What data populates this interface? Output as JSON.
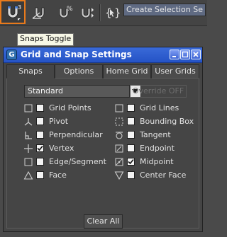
{
  "toolbar": {
    "tools": [
      {
        "icon": "snaps-toggle-icon",
        "sub": "3"
      },
      {
        "icon": "angle-snap-icon"
      },
      {
        "icon": "percent-snap-icon"
      },
      {
        "icon": "spinner-snap-icon"
      },
      {
        "icon": "edit-named-selection-icon",
        "text": "{}"
      }
    ],
    "selection_set_value": "Create Selection Se"
  },
  "tooltip": {
    "text": "Snaps Toggle"
  },
  "dialog": {
    "title": "Grid and Snap Settings",
    "title_icon_text": "G",
    "tabs": [
      "Snaps",
      "Options",
      "Home Grid",
      "User Grids"
    ],
    "active_tab": "Snaps",
    "dropdown_value": "Standard",
    "override_label": "Override OFF",
    "snaps_left": [
      {
        "label": "Grid Points",
        "icon": "grid-points-icon",
        "checked": false
      },
      {
        "label": "Pivot",
        "icon": "pivot-icon",
        "checked": false
      },
      {
        "label": "Perpendicular",
        "icon": "perpendicular-icon",
        "checked": false
      },
      {
        "label": "Vertex",
        "icon": "vertex-icon",
        "checked": true
      },
      {
        "label": "Edge/Segment",
        "icon": "edge-segment-icon",
        "checked": false
      },
      {
        "label": "Face",
        "icon": "face-icon",
        "checked": false
      }
    ],
    "snaps_right": [
      {
        "label": "Grid Lines",
        "icon": "grid-lines-icon",
        "checked": false
      },
      {
        "label": "Bounding Box",
        "icon": "bounding-box-icon",
        "checked": false
      },
      {
        "label": "Tangent",
        "icon": "tangent-icon",
        "checked": false
      },
      {
        "label": "Endpoint",
        "icon": "endpoint-icon",
        "checked": false
      },
      {
        "label": "Midpoint",
        "icon": "midpoint-icon",
        "checked": true
      },
      {
        "label": "Center Face",
        "icon": "center-face-icon",
        "checked": false
      }
    ],
    "clear_all_label": "Clear All"
  },
  "colors": {
    "accent_orange": "#e87a1c",
    "titlebar_blue": "#2553c6",
    "panel": "#454545"
  }
}
